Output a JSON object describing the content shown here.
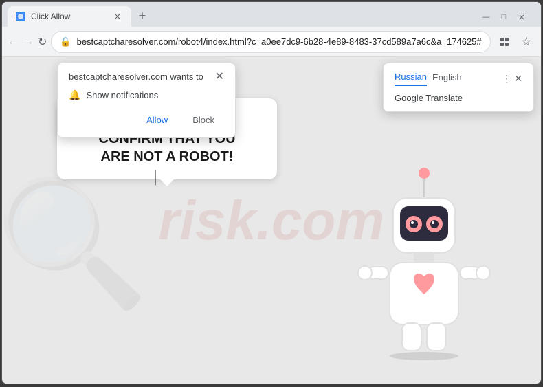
{
  "window": {
    "title": "Click Allow",
    "controls": {
      "minimize": "—",
      "maximize": "□",
      "close": "✕"
    }
  },
  "tab": {
    "label": "Click Allow",
    "close": "✕",
    "new_tab": "+"
  },
  "toolbar": {
    "back": "←",
    "forward": "→",
    "refresh": "↻",
    "url": "bestcaptcharesolver.com/robot4/index.html?c=a0ee7dc9-6b28-4e89-8483-37cd589a7a6c&a=174625#",
    "bookmark": "☆",
    "profile": "●",
    "menu": "⋮"
  },
  "notification_popup": {
    "title": "bestcaptcharesolver.com wants to",
    "close": "✕",
    "permission_text": "Show notifications",
    "allow_label": "Allow",
    "block_label": "Block"
  },
  "translate_popup": {
    "tab_russian": "Russian",
    "tab_english": "English",
    "menu_icon": "⋮",
    "close": "✕",
    "body": "Google Translate"
  },
  "speech_bubble": {
    "line1": "CLICK «ALLOW» TO CONFIRM THAT YOU",
    "line2": "ARE NOT A ROBOT!"
  },
  "watermark": {
    "text": "risk.com"
  }
}
